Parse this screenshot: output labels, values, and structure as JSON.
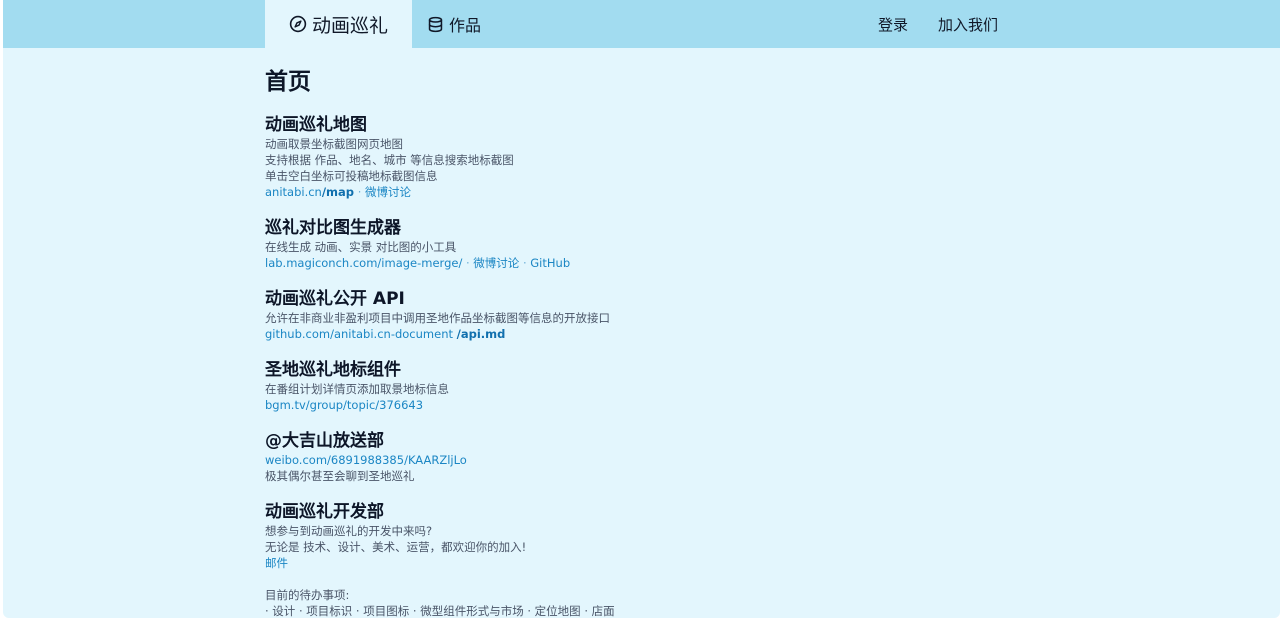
{
  "header": {
    "brand_label": "动画巡礼",
    "brand_icon": "compass-icon",
    "works_label": "作品",
    "works_icon": "database-icon",
    "login_label": "登录",
    "join_label": "加入我们"
  },
  "colors": {
    "header_bg": "#a2dcf0",
    "page_bg": "#e3f6fd",
    "link": "#1b86c4"
  },
  "page": {
    "title": "首页"
  },
  "sections": {
    "map": {
      "title": "动画巡礼地图",
      "lines": [
        "动画取景坐标截图网页地图",
        "支持根据 作品、地名、城市 等信息搜索地标截图",
        "单击空白坐标可投稿地标截图信息"
      ],
      "link_prefix": "anitabi.cn",
      "link_bold": "/map",
      "sep": " · ",
      "link2": "微博讨论"
    },
    "compare": {
      "title": "巡礼对比图生成器",
      "lines": [
        "在线生成 动画、实景 对比图的小工具"
      ],
      "link1": "lab.magiconch.com/image-merge/",
      "sep": " · ",
      "link2": "微博讨论",
      "link3": "GitHub"
    },
    "api": {
      "title": "动画巡礼公开 API",
      "lines": [
        "允许在非商业非盈利项目中调用圣地作品坐标截图等信息的开放接口"
      ],
      "link_prefix": "github.com/anitabi.cn-document ",
      "link_bold": "/api.md"
    },
    "widget": {
      "title": "圣地巡礼地标组件",
      "lines": [
        "在番组计划详情页添加取景地标信息"
      ],
      "link1": "bgm.tv/group/topic/376643"
    },
    "broadcast": {
      "title": "@大吉山放送部",
      "link1": "weibo.com/6891988385/KAARZljLo",
      "lines": [
        "极其偶尔甚至会聊到圣地巡礼"
      ]
    },
    "dev": {
      "title": "动画巡礼开发部",
      "lines": [
        "想参与到动画巡礼的开发中来吗?",
        "无论是 技术、设计、美术、运营，都欢迎你的加入!"
      ],
      "link1": "邮件",
      "todo_label": "目前的待办事项:",
      "todo_items": "· 设计 · 项目标识 · 项目图标 · 微型组件形式与市场 · 定位地图 · 店面"
    }
  }
}
